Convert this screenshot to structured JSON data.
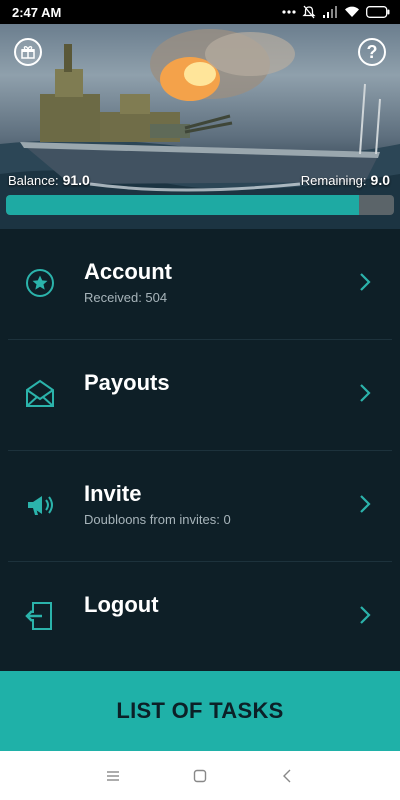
{
  "status_bar": {
    "time": "2:47 AM",
    "icons": [
      "more-dots-icon",
      "mute-icon",
      "signal-icon",
      "wifi-icon",
      "battery-icon"
    ]
  },
  "hero": {
    "gift_icon": "gift-icon",
    "help_icon": "help-icon",
    "help_glyph": "?",
    "balance_label": "Balance:",
    "balance_value": "91.0",
    "remaining_label": "Remaining:",
    "remaining_value": "9.0",
    "progress_fraction": 0.91
  },
  "menu": {
    "items": [
      {
        "title": "Account",
        "subtitle": "Received: 504",
        "icon": "star-icon"
      },
      {
        "title": "Payouts",
        "subtitle": "",
        "icon": "envelope-icon"
      },
      {
        "title": "Invite",
        "subtitle": "Doubloons from invites: 0",
        "icon": "megaphone-icon"
      },
      {
        "title": "Logout",
        "subtitle": "",
        "icon": "logout-icon"
      }
    ]
  },
  "cta": {
    "label": "LIST OF TASKS"
  },
  "nav": {
    "icons": [
      "menu-icon",
      "home-icon",
      "back-icon"
    ]
  },
  "colors": {
    "accent": "#1fb1a8",
    "background": "#0e1f27",
    "progress_track": "#5b6469"
  }
}
